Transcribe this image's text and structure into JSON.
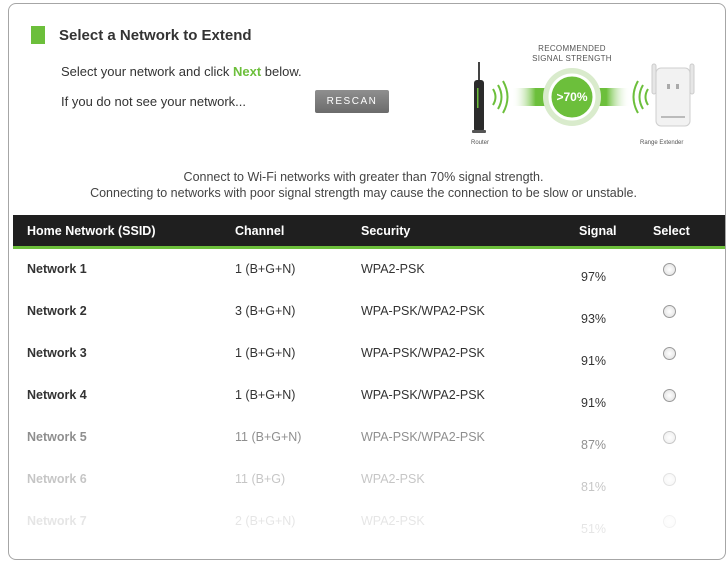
{
  "header": {
    "title": "Select a Network to Extend",
    "instruction_prefix": "Select your network and click ",
    "instruction_highlight": "Next",
    "instruction_suffix": " below.",
    "not_found_text": "If you do not see your network...",
    "rescan_label": "RESCAN"
  },
  "illustration": {
    "recommended_label_1": "RECOMMENDED",
    "recommended_label_2": "SIGNAL STRENGTH",
    "threshold": ">70%",
    "router_label": "Router",
    "extender_label": "Range Extender",
    "accent_color": "#6cbf3b"
  },
  "notice": {
    "line1": "Connect to Wi-Fi networks with greater than 70% signal strength.",
    "line2": "Connecting to networks with poor signal strength may cause the connection to be slow or unstable."
  },
  "table": {
    "headers": [
      "Home Network (SSID)",
      "Channel",
      "Security",
      "Signal",
      "Select"
    ],
    "rows": [
      {
        "ssid": "Network 1",
        "channel": "1 (B+G+N)",
        "security": "WPA2-PSK",
        "signal": "97%"
      },
      {
        "ssid": "Network 2",
        "channel": "3 (B+G+N)",
        "security": "WPA-PSK/WPA2-PSK",
        "signal": "93%"
      },
      {
        "ssid": "Network 3",
        "channel": "1 (B+G+N)",
        "security": "WPA-PSK/WPA2-PSK",
        "signal": "91%"
      },
      {
        "ssid": "Network 4",
        "channel": "1 (B+G+N)",
        "security": "WPA-PSK/WPA2-PSK",
        "signal": "91%"
      },
      {
        "ssid": "Network 5",
        "channel": "11 (B+G+N)",
        "security": "WPA-PSK/WPA2-PSK",
        "signal": "87%"
      },
      {
        "ssid": "Network 6",
        "channel": "11 (B+G)",
        "security": "WPA2-PSK",
        "signal": "81%"
      },
      {
        "ssid": "Network 7",
        "channel": "2 (B+G+N)",
        "security": "WPA2-PSK",
        "signal": "51%"
      }
    ],
    "good_signal_color": "#6cbf3b",
    "poor_signal_color": "#e0506a"
  }
}
